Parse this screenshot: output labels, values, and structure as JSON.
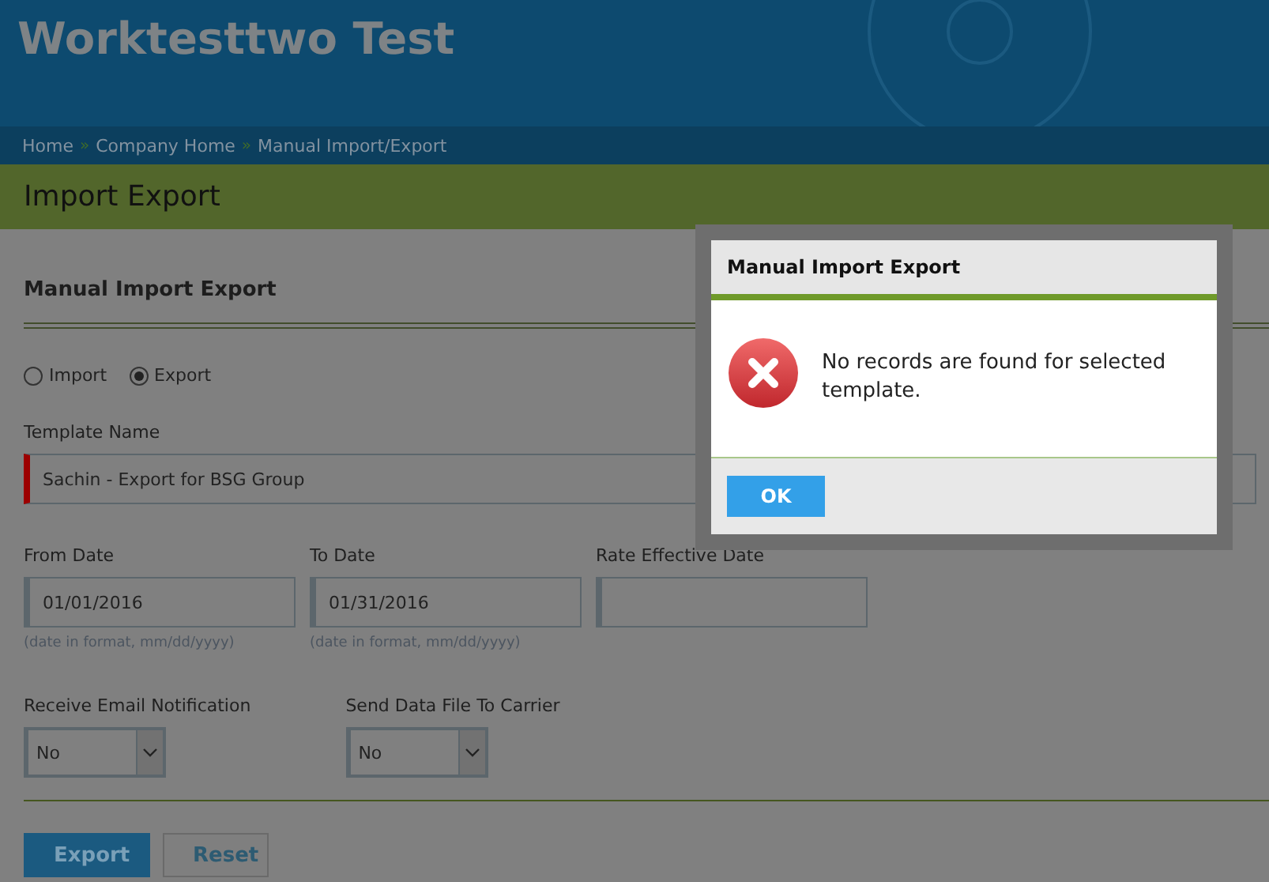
{
  "header": {
    "title": "Worktesttwo Test"
  },
  "breadcrumb": [
    {
      "label": "Home"
    },
    {
      "label": "Company Home"
    },
    {
      "label": "Manual Import/Export"
    }
  ],
  "breadcrumb_separator": "»",
  "page_title": "Import Export",
  "section_title": "Manual Import Export",
  "mode_options": [
    {
      "label": "Import",
      "selected": false
    },
    {
      "label": "Export",
      "selected": true
    }
  ],
  "template": {
    "label": "Template Name",
    "value": "Sachin - Export for BSG Group",
    "required": true
  },
  "dates": [
    {
      "label": "From Date",
      "value": "01/01/2016",
      "hint": "(date in format, mm/dd/yyyy)"
    },
    {
      "label": "To Date",
      "value": "01/31/2016",
      "hint": "(date in format, mm/dd/yyyy)"
    },
    {
      "label": "Rate Effective Date"
    }
  ],
  "selects": [
    {
      "label": "Receive Email Notification",
      "value": "No"
    },
    {
      "label": "Send Data File To Carrier",
      "value": "No"
    }
  ],
  "buttons": [
    {
      "label": "Export",
      "kind": "primary"
    },
    {
      "label": "Reset",
      "kind": "secondary"
    }
  ],
  "dialog": {
    "title": "Manual Import Export",
    "message": "No records are found for selected template.",
    "button": "OK"
  }
}
